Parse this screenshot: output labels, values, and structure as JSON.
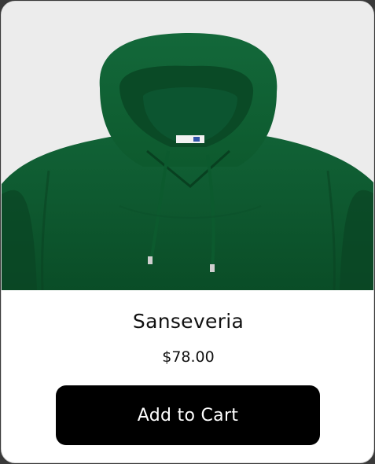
{
  "product": {
    "name": "Sanseveria",
    "price": "$78.00",
    "image_icon": "green-hoodie-image"
  },
  "actions": {
    "add_to_cart_label": "Add to Cart"
  },
  "colors": {
    "hoodie_green": "#0e5a2c",
    "button_bg": "#000000",
    "button_text": "#ffffff",
    "image_bg": "#ececec"
  }
}
